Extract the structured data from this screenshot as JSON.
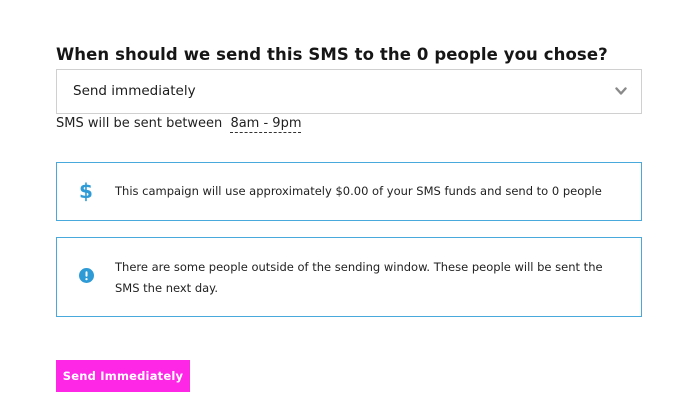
{
  "form": {
    "question": "When should we send this SMS to the 0 people you chose?",
    "send_timing": {
      "selected": "Send immediately",
      "icon": "chevron-down-icon"
    },
    "sending_window": {
      "label": "SMS will be sent between",
      "range": "8am - 9pm"
    }
  },
  "notices": {
    "cost": {
      "icon": "dollar-icon",
      "text": "This campaign will use approximately $0.00 of your SMS funds and send to 0 people"
    },
    "outside_window": {
      "icon": "info-icon",
      "text": "There are some people outside of the sending window. These people will be sent the SMS the next day."
    }
  },
  "actions": {
    "submit_label": "Send Immediately"
  },
  "colors": {
    "accent_button": "#ff27e6",
    "notice_border": "#4aa9dc",
    "icon_blue": "#2f9bd6"
  }
}
